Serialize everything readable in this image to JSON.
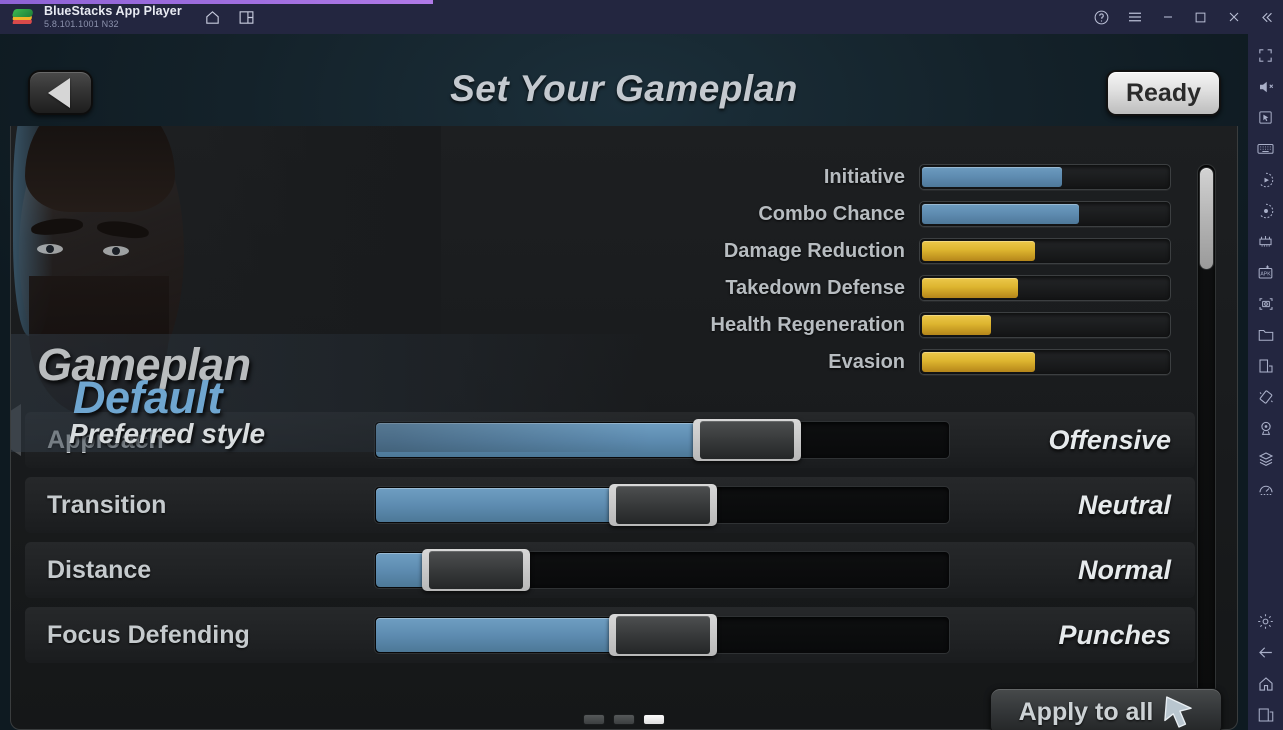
{
  "titlebar": {
    "app_name": "BlueStacks App Player",
    "version": "5.8.101.1001  N32",
    "icons": [
      {
        "name": "home-icon",
        "glyph": "home"
      },
      {
        "name": "multi-instance-icon",
        "glyph": "instances"
      }
    ],
    "window_controls": [
      {
        "name": "help-button",
        "glyph": "question"
      },
      {
        "name": "menu-button",
        "glyph": "hamburger"
      },
      {
        "name": "minimize-button",
        "glyph": "minimize"
      },
      {
        "name": "maximize-button",
        "glyph": "maximize"
      },
      {
        "name": "close-button",
        "glyph": "close"
      },
      {
        "name": "collapse-sidebar-button",
        "glyph": "double-chevron-left"
      }
    ],
    "accent_color": "#a06fe0",
    "background_color": "#232640"
  },
  "sidebar": {
    "items": [
      {
        "name": "fullscreen-icon",
        "label": "Fullscreen"
      },
      {
        "name": "mute-icon",
        "label": "Mute"
      },
      {
        "name": "cursor-icon",
        "label": "Game controls"
      },
      {
        "name": "keyboard-icon",
        "label": "Keyboard controls"
      },
      {
        "name": "macro-recorder-icon",
        "label": "Macro recorder"
      },
      {
        "name": "script-icon",
        "label": "Script"
      },
      {
        "name": "gamepad-icon",
        "label": "Gamepad"
      },
      {
        "name": "install-apk-icon",
        "label": "Install APK"
      },
      {
        "name": "screenshot-icon",
        "label": "Screenshot"
      },
      {
        "name": "media-folder-icon",
        "label": "Media manager"
      },
      {
        "name": "multi-instance-manager-icon",
        "label": "Multi-instance manager"
      },
      {
        "name": "tilt-icon",
        "label": "Tilt controls"
      },
      {
        "name": "location-icon",
        "label": "Location"
      },
      {
        "name": "layers-icon",
        "label": "Layers"
      },
      {
        "name": "performance-icon",
        "label": "Performance"
      }
    ],
    "bottom_items": [
      {
        "name": "settings-gear-icon",
        "label": "Settings"
      },
      {
        "name": "back-arrow-icon",
        "label": "Back"
      },
      {
        "name": "home-icon",
        "label": "Home"
      },
      {
        "name": "recents-icon",
        "label": "Recent apps"
      }
    ]
  },
  "game": {
    "header": {
      "title": "Set Your Gameplan",
      "back_button": "back",
      "ready_button": "Ready"
    },
    "gameplan": {
      "heading": "Gameplan",
      "name": "Default",
      "subtitle": "Preferred style"
    },
    "stats": {
      "rows": [
        {
          "label": "Initiative",
          "value": 57,
          "color": "blue"
        },
        {
          "label": "Combo Chance",
          "value": 64,
          "color": "blue"
        },
        {
          "label": "Damage Reduction",
          "value": 46,
          "color": "gold"
        },
        {
          "label": "Takedown Defense",
          "value": 39,
          "color": "gold"
        },
        {
          "label": "Health Regeneration",
          "value": 28,
          "color": "gold"
        },
        {
          "label": "Evasion",
          "value": 46,
          "color": "gold"
        }
      ],
      "blue_color": "#5e8bb0",
      "gold_color": "#ddb52f"
    },
    "sliders": [
      {
        "label": "Approach",
        "value": "Offensive",
        "position": 68
      },
      {
        "label": "Transition",
        "value": "Neutral",
        "position": 50
      },
      {
        "label": "Distance",
        "value": "Normal",
        "position": 10
      },
      {
        "label": "Focus Defending",
        "value": "Punches",
        "position": 50
      }
    ],
    "pager": {
      "pages": 3,
      "active": 3
    },
    "apply_button": {
      "label": "Apply to all",
      "icon": "cursor-arrow-icon"
    }
  }
}
